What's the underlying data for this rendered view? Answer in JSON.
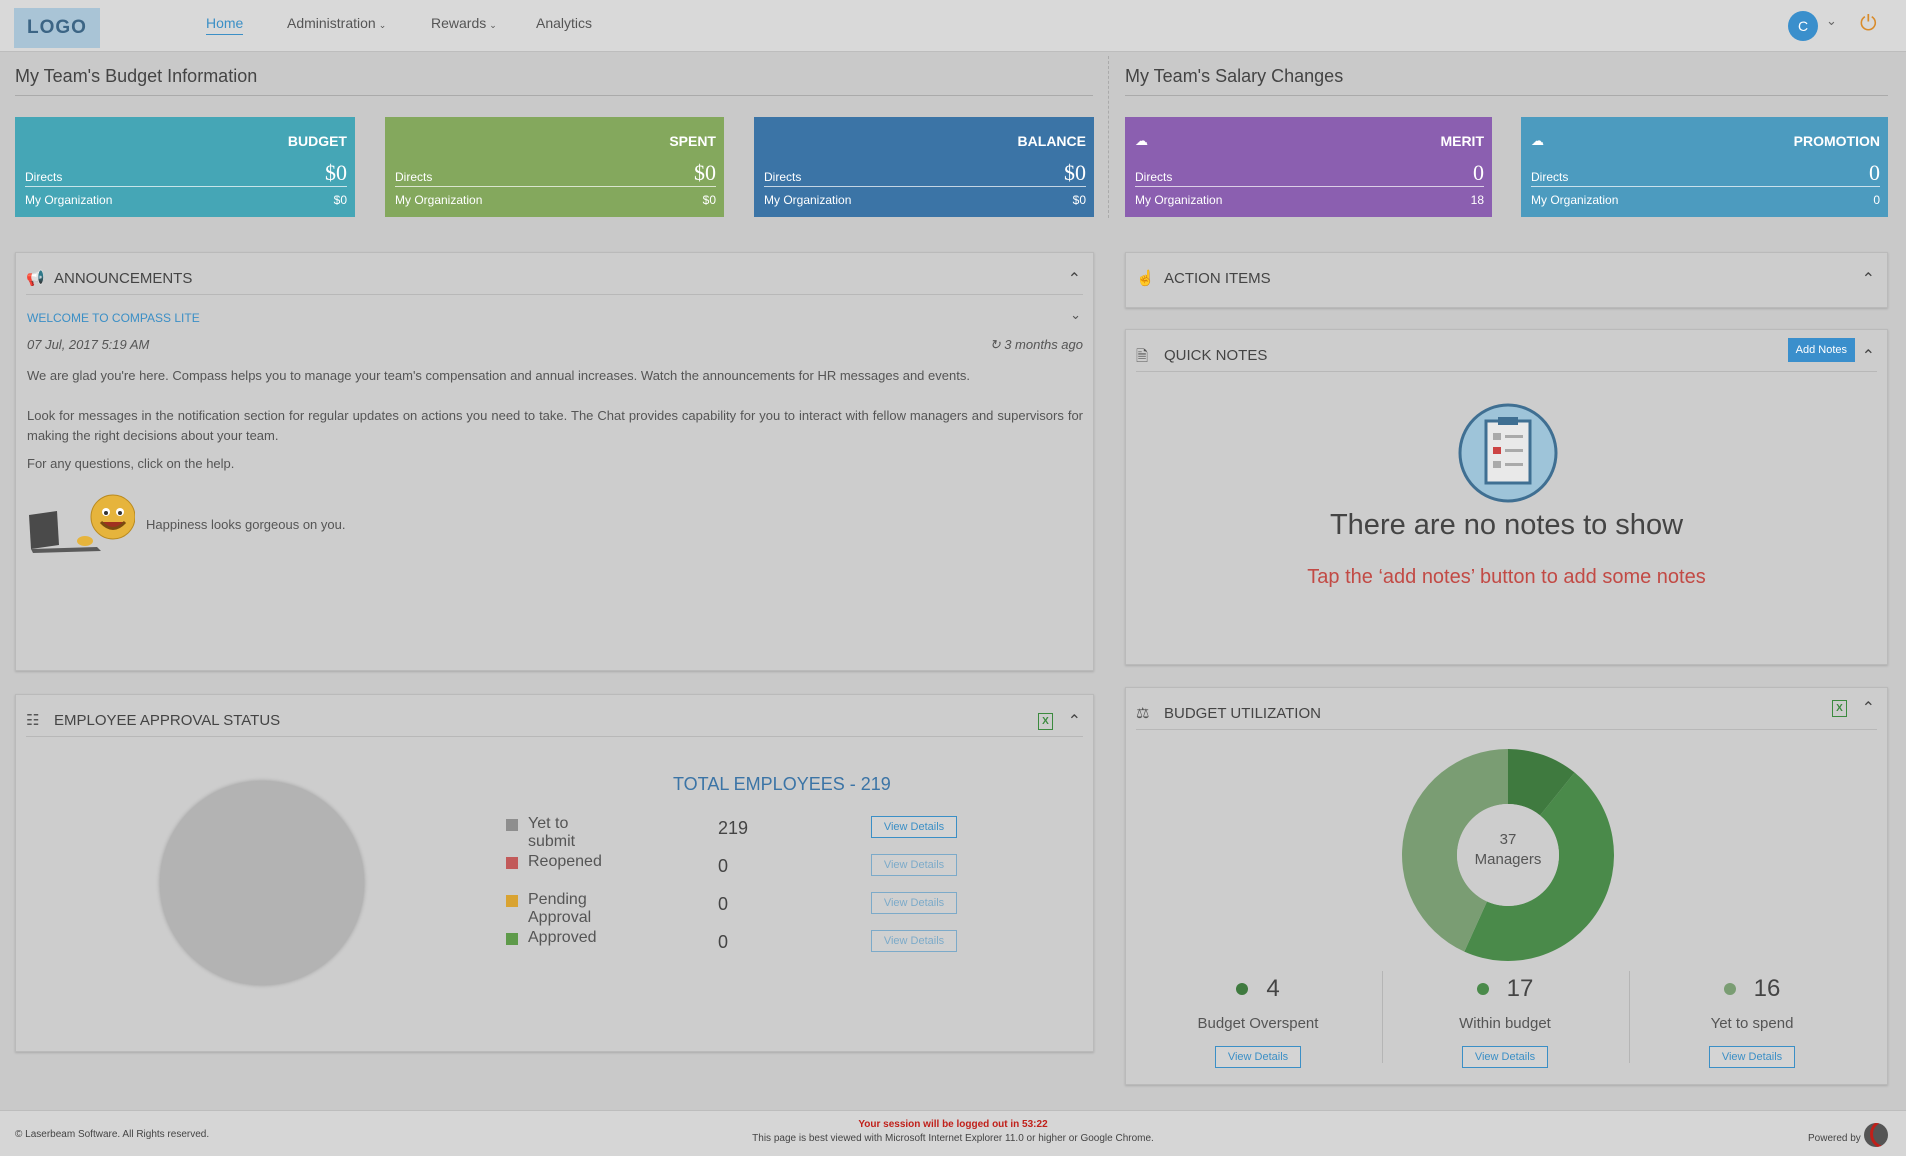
{
  "nav": {
    "logo": "LOGO",
    "home": "Home",
    "administration": "Administration",
    "rewards": "Rewards",
    "analytics": "Analytics",
    "avatar_initial": "C"
  },
  "budget_section": {
    "title": "My Team's Budget Information",
    "cards": [
      {
        "title": "BUDGET",
        "directs_label": "Directs",
        "directs_value": "$0",
        "org_label": "My Organization",
        "org_value": "$0",
        "color": "#45a6b6"
      },
      {
        "title": "SPENT",
        "directs_label": "Directs",
        "directs_value": "$0",
        "org_label": "My Organization",
        "org_value": "$0",
        "color": "#84a85d"
      },
      {
        "title": "BALANCE",
        "directs_label": "Directs",
        "directs_value": "$0",
        "org_label": "My Organization",
        "org_value": "$0",
        "color": "#3b74a6"
      }
    ]
  },
  "salary_section": {
    "title": "My Team's Salary Changes",
    "cards": [
      {
        "title": "MERIT",
        "directs_label": "Directs",
        "directs_value": "0",
        "org_label": "My Organization",
        "org_value": "18",
        "color": "#8b5fb0"
      },
      {
        "title": "PROMOTION",
        "directs_label": "Directs",
        "directs_value": "0",
        "org_label": "My Organization",
        "org_value": "0",
        "color": "#4c9bbf"
      }
    ]
  },
  "announcements": {
    "title": "ANNOUNCEMENTS",
    "item_title": "WELCOME TO COMPASS LITE",
    "date": "07 Jul, 2017 5:19 AM",
    "ago": "3 months ago",
    "para1": "We are glad you're here. Compass helps you to manage your team's compensation and annual increases. Watch the announcements for HR messages and events.",
    "para2": "Look for messages in the notification section for regular updates on actions you need to take. The Chat provides capability for you to interact with fellow managers and supervisors for making the right decisions about your team.",
    "para3": "For any questions, click on the help.",
    "happiness": "Happiness looks gorgeous on you."
  },
  "action_items": {
    "title": "ACTION ITEMS"
  },
  "quick_notes": {
    "title": "QUICK NOTES",
    "add_button": "Add Notes",
    "empty_title": "There are no notes to show",
    "empty_hint": "Tap the ‘add notes’ button to add some notes"
  },
  "approval": {
    "title": "EMPLOYEE APPROVAL STATUS",
    "total": "TOTAL EMPLOYEES - 219",
    "view_details": "View Details",
    "rows": [
      {
        "label": "Yet to submit",
        "count": "219",
        "color": "#8e8e8e"
      },
      {
        "label": "Reopened",
        "count": "0",
        "color": "#c25a5a"
      },
      {
        "label": "Pending Approval",
        "count": "0",
        "color": "#d9a331"
      },
      {
        "label": "Approved",
        "count": "0",
        "color": "#5e9a4a"
      }
    ]
  },
  "budget_util": {
    "title": "BUDGET UTILIZATION",
    "center_value": "37",
    "center_label": "Managers",
    "view_details": "View Details",
    "stats": [
      {
        "value": "4",
        "label": "Budget Overspent",
        "color": "#3f7a3f"
      },
      {
        "value": "17",
        "label": "Within budget",
        "color": "#4a8a4a"
      },
      {
        "value": "16",
        "label": "Yet to spend",
        "color": "#7a9d73"
      }
    ]
  },
  "chart_data": {
    "type": "pie",
    "categories": [
      "Budget Overspent",
      "Within budget",
      "Yet to spend"
    ],
    "values": [
      4,
      17,
      16
    ],
    "colors": [
      "#3f7a3f",
      "#4a8a4a",
      "#7a9d73"
    ]
  },
  "footer": {
    "copyright": "© Laserbeam Software. All Rights reserved.",
    "session": "Your session will be logged out in 53:22",
    "browser": "This page is best viewed with Microsoft Internet Explorer 11.0 or higher or Google Chrome.",
    "powered": "Powered by"
  }
}
